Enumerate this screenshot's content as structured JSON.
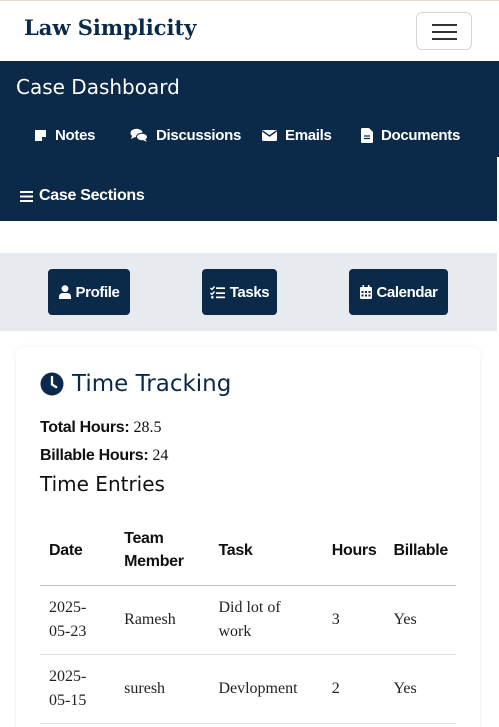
{
  "navbar": {
    "brand": "Law Simplicity",
    "menu_icon": "hamburger-menu-icon"
  },
  "dashboard": {
    "title": "Case Dashboard",
    "nav": [
      {
        "label": "Notes",
        "icon": "sticky-note-icon"
      },
      {
        "label": "Discussions",
        "icon": "comments-icon"
      },
      {
        "label": "Emails",
        "icon": "envelope-icon"
      },
      {
        "label": "Documents",
        "icon": "file-icon"
      }
    ],
    "sections": {
      "label": "Case Sections",
      "icon": "list-icon"
    }
  },
  "actions": [
    {
      "label": "Profile",
      "icon": "user-icon"
    },
    {
      "label": "Tasks",
      "icon": "checklist-icon"
    },
    {
      "label": "Calendar",
      "icon": "calendar-icon"
    }
  ],
  "time_tracking": {
    "title": "Time Tracking",
    "icon": "clock-icon",
    "total_label": "Total Hours:",
    "total_value": "28.5",
    "billable_label": "Billable Hours:",
    "billable_value": "24",
    "entries_title": "Time Entries",
    "columns": [
      "Date",
      "Team Member",
      "Task",
      "Hours",
      "Billable"
    ],
    "rows": [
      {
        "date": "2025-05-23",
        "member": "Ramesh",
        "task": "Did lot of work",
        "hours": "3",
        "billable": "Yes"
      },
      {
        "date": "2025-05-15",
        "member": "suresh",
        "task": "Devlopment",
        "hours": "2",
        "billable": "Yes"
      }
    ]
  },
  "colors": {
    "primary": "#0b2a4a",
    "band": "#e7ebf0",
    "background": "#ffffff"
  }
}
